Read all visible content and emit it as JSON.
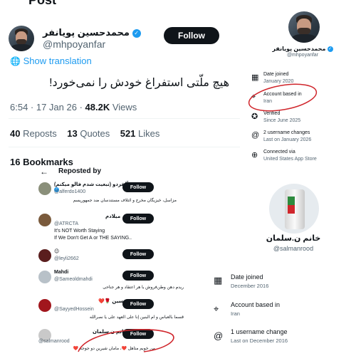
{
  "tweet": {
    "top_cut_text": "Post",
    "author_name": "محمدحسین پویانفر",
    "author_handle": "@mhpoyanfar",
    "follow_label": "Follow",
    "show_translation": "Show translation",
    "text": "هیچ ملّتی استفراغ خودش را نمی‌خورد!",
    "time": "6:54 · 17 Jan 26 · ",
    "views_count": "48.2K",
    "views_label": "Views",
    "reposts_count": "40",
    "reposts_label": "Reposts",
    "quotes_count": "13",
    "quotes_label": "Quotes",
    "likes_count": "521",
    "likes_label": "Likes",
    "bookmarks_cut": "16 Bookmarks"
  },
  "about_top": {
    "name": "محمدحسین پویانفر",
    "handle": "@mhpoyanfar",
    "items": [
      {
        "icon": "calendar-icon",
        "title": "Date joined",
        "sub": "January 2020"
      },
      {
        "icon": "location-icon",
        "title": "Account based in",
        "sub": "Iran"
      },
      {
        "icon": "verified-icon",
        "title": "Verified",
        "sub": "Since June 2025"
      },
      {
        "icon": "at-icon",
        "title": "2 username changes",
        "sub": "Last on January 2026"
      },
      {
        "icon": "globe-icon",
        "title": "Connected via",
        "sub": "United States App Store"
      }
    ]
  },
  "reposted": {
    "title": "Reposted by",
    "follow_label": "Follow",
    "users": [
      {
        "name": "آلفردو (تبعیت شدم فالو میکنم)",
        "handle": "@alferdo1400",
        "bio": "مزاسل، خیزیگان مخرج و ائتلاف مستندسان ضد جمهوریسم",
        "bio2": ""
      },
      {
        "name": "میلادم",
        "handle": "@ATRCTA",
        "bio": "It's NOT Worth Staying",
        "bio2": "If We Don't Get A or THE SAYING.."
      },
      {
        "name": "😉",
        "handle": "@leyli2662",
        "bio": "",
        "bio2": ""
      },
      {
        "name": "Mahdi",
        "handle": "@Sameoldmahdi",
        "bio": "ریدم دهن وطن‌فروش با هر اعتقاد و هر جناحی",
        "bio2": ""
      },
      {
        "name": "❤️🌹 حسین",
        "handle": "@SayyedHossein",
        "bio": "قسما بالعباس و ام البنين إنا على العهد على يا نصرالله",
        "bio2": ""
      },
      {
        "name": "خانم ن.سلمان",
        "handle": "@salmanrood",
        "bio": "من خوبم متاهل ❤️، مامان شیرین دو جوجه ❤️",
        "bio2": ""
      }
    ]
  },
  "about_bottom": {
    "name": "خانم ن.سلمان",
    "handle": "@salmanrood",
    "items": [
      {
        "icon": "calendar-icon",
        "title": "Date joined",
        "sub": "December 2016"
      },
      {
        "icon": "location-icon",
        "title": "Account based in",
        "sub": "Iran"
      },
      {
        "icon": "at-icon",
        "title": "1 username change",
        "sub": "Last on December 2016"
      }
    ]
  }
}
